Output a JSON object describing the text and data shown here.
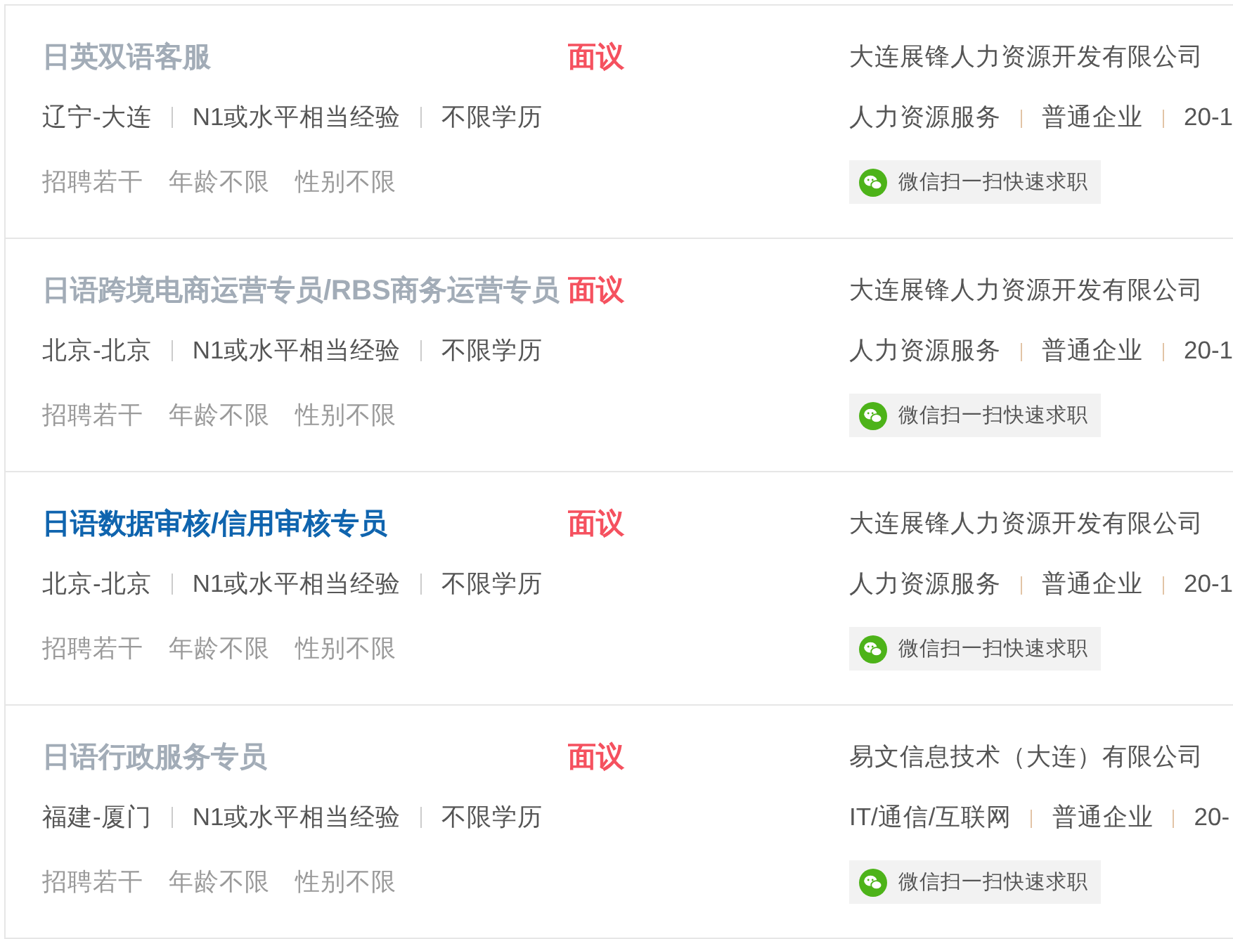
{
  "jobs": [
    {
      "title": "日英双语客服",
      "highlighted": false,
      "salary": "面议",
      "info": [
        "辽宁-大连",
        "N1或水平相当经验",
        "不限学历"
      ],
      "conditions": [
        "招聘若干",
        "年龄不限",
        "性别不限"
      ],
      "company": "大连展锋人力资源开发有限公司",
      "company_tags": [
        "人力资源服务",
        "普通企业",
        "20-1"
      ],
      "apply_button": "微信扫一扫快速求职"
    },
    {
      "title": "日语跨境电商运营专员/RBS商务运营专员",
      "highlighted": false,
      "salary": "面议",
      "info": [
        "北京-北京",
        "N1或水平相当经验",
        "不限学历"
      ],
      "conditions": [
        "招聘若干",
        "年龄不限",
        "性别不限"
      ],
      "company": "大连展锋人力资源开发有限公司",
      "company_tags": [
        "人力资源服务",
        "普通企业",
        "20-1"
      ],
      "apply_button": "微信扫一扫快速求职"
    },
    {
      "title": "日语数据审核/信用审核专员",
      "highlighted": true,
      "salary": "面议",
      "info": [
        "北京-北京",
        "N1或水平相当经验",
        "不限学历"
      ],
      "conditions": [
        "招聘若干",
        "年龄不限",
        "性别不限"
      ],
      "company": "大连展锋人力资源开发有限公司",
      "company_tags": [
        "人力资源服务",
        "普通企业",
        "20-1"
      ],
      "apply_button": "微信扫一扫快速求职"
    },
    {
      "title": "日语行政服务专员",
      "highlighted": false,
      "salary": "面议",
      "info": [
        "福建-厦门",
        "N1或水平相当经验",
        "不限学历"
      ],
      "conditions": [
        "招聘若干",
        "年龄不限",
        "性别不限"
      ],
      "company": "易文信息技术（大连）有限公司",
      "company_tags": [
        "IT/通信/互联网",
        "普通企业",
        "20-"
      ],
      "apply_button": "微信扫一扫快速求职"
    }
  ]
}
